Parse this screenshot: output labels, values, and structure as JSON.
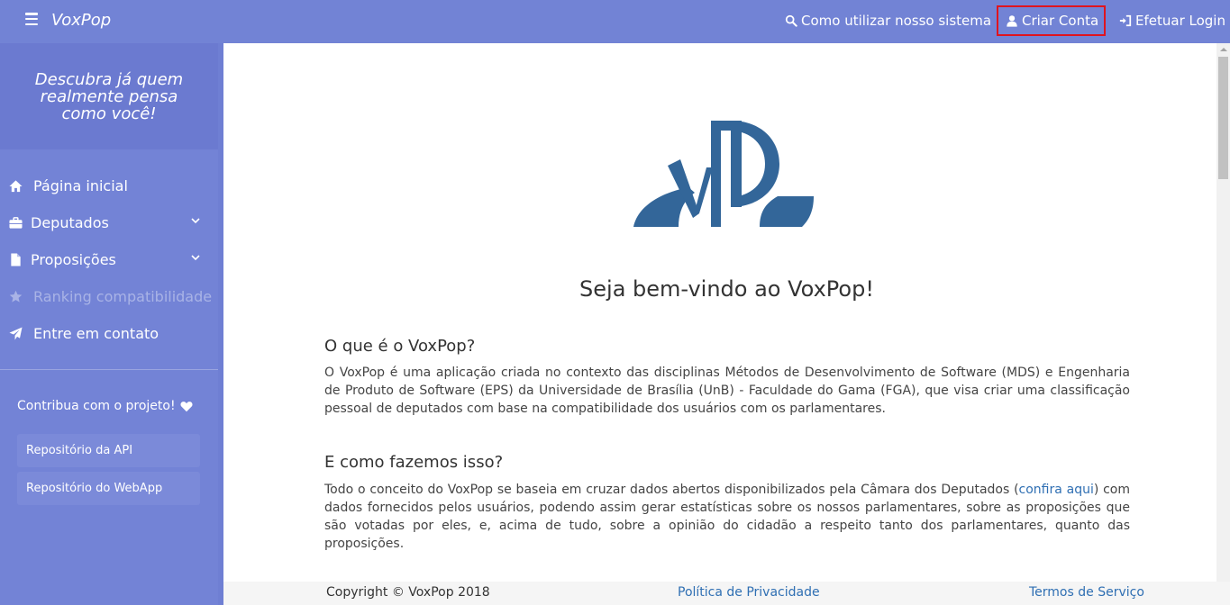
{
  "header": {
    "brand": "VoxPop",
    "nav": {
      "how_to": "Como utilizar nosso sistema",
      "signup": "Criar Conta",
      "login": "Efetuar Login"
    }
  },
  "sidebar": {
    "tagline": "Descubra já quem realmente pensa como você!",
    "items": [
      {
        "label": "Página inicial",
        "icon": "home-icon"
      },
      {
        "label": "Deputados",
        "icon": "briefcase-icon"
      },
      {
        "label": "Proposições",
        "icon": "document-icon"
      },
      {
        "label": "Ranking compatibilidade",
        "icon": "star-icon"
      },
      {
        "label": "Entre em contato",
        "icon": "send-icon"
      }
    ],
    "contribute": "Contribua com o projeto!",
    "repos": {
      "api": "Repositório da API",
      "webapp": "Repositório do WebApp"
    }
  },
  "main": {
    "welcome": "Seja bem-vindo ao VoxPop!",
    "section1": {
      "title": "O que é o VoxPop?",
      "text": "O VoxPop é uma aplicação criada no contexto das disciplinas Métodos de Desenvolvimento de Software (MDS) e Engenharia de Produto de Software (EPS) da Universidade de Brasília (UnB) - Faculdade do Gama (FGA), que visa criar uma classificação pessoal de deputados com base na compatibilidade dos usuários com os parlamentares."
    },
    "section2": {
      "title": "E como fazemos isso?",
      "text_before": "Todo o conceito do VoxPop se baseia em cruzar dados abertos disponibilizados pela Câmara dos Deputados (",
      "link": "confira aqui",
      "text_after": ") com dados fornecidos pelos usuários, podendo assim gerar estatísticas sobre os nossos parlamentares, sobre as proposições que são votadas por eles, e, acima de tudo, sobre a opinião do cidadão a respeito tanto dos parlamentares, quanto das proposições."
    }
  },
  "footer": {
    "copyright": "Copyright © VoxPop 2018",
    "privacy": "Política de Privacidade",
    "terms": "Termos de Serviço"
  },
  "colors": {
    "header": "#7283d5",
    "sidebar": "#7383d6",
    "logo": "#336699",
    "link": "#2f6fb3",
    "highlight_border": "#e0141e"
  }
}
